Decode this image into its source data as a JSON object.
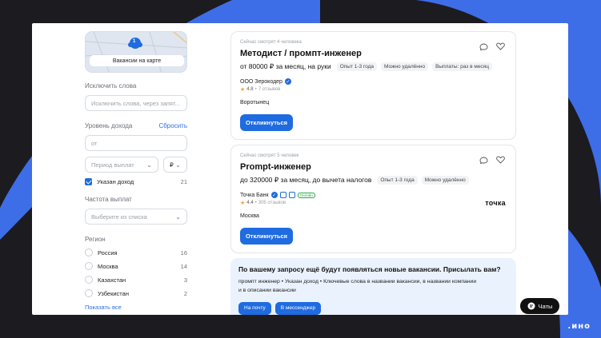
{
  "brand": ".ино",
  "filters": {
    "map_button": "Вакансии на карте",
    "map_count": "1",
    "exclude": {
      "label": "Исключить слова",
      "placeholder": "Исключить слова, через запят..."
    },
    "income": {
      "label": "Уровень дохода",
      "reset": "Сбросить",
      "from_placeholder": "от",
      "period_placeholder": "Период выплат",
      "currency": "₽",
      "specified_label": "Указан доход",
      "specified_count": "21",
      "specified_checked": true
    },
    "payment_frequency": {
      "label": "Частота выплат",
      "placeholder": "Выберите из списка"
    },
    "region": {
      "label": "Регион",
      "items": [
        {
          "name": "Россия",
          "count": "16"
        },
        {
          "name": "Москва",
          "count": "14"
        },
        {
          "name": "Казахстан",
          "count": "3"
        },
        {
          "name": "Узбекистан",
          "count": "2"
        }
      ],
      "show_all": "Показать все"
    }
  },
  "vacancies": [
    {
      "watchers": "Сейчас смотрят 4 человека",
      "title": "Методист / промпт-инженер",
      "salary": "от 80000 ₽ за месяц, на руки",
      "tags": [
        "Опыт 1-3 года",
        "Можно удалённо",
        "Выплаты: раз в месяц"
      ],
      "company": "ООО Зерокодер",
      "rating": "4.8",
      "reviews": "7 отзывов",
      "city": "Воротынец",
      "apply": "Откликнуться"
    },
    {
      "watchers": "Сейчас смотрят 5 человек",
      "title": "Prompt-инженер",
      "salary": "до 320000 ₽ за месяц, до вычета налогов",
      "tags": [
        "Опыт 1-3 года",
        "Можно удалённо"
      ],
      "company": "Точка Банк",
      "online_badge": "Онлайн",
      "rating": "4.4",
      "reviews": "305 отзывов",
      "city": "Москва",
      "logo_text": "точка",
      "apply": "Откликнуться"
    }
  ],
  "subscribe": {
    "title": "По вашему запросу ещё будут появляться новые вакансии. Присылать вам?",
    "text": "промпт инженер • Указан доход • Ключевые слова в названии вакансии, в названии компании и в описании вакансии",
    "button_email": "На почту",
    "button_messenger": "В мессенджер"
  },
  "chats_button": "Чаты",
  "colors": {
    "accent": "#1f6be0",
    "swoosh": "#3e6de8",
    "background": "#1c1b1f"
  }
}
